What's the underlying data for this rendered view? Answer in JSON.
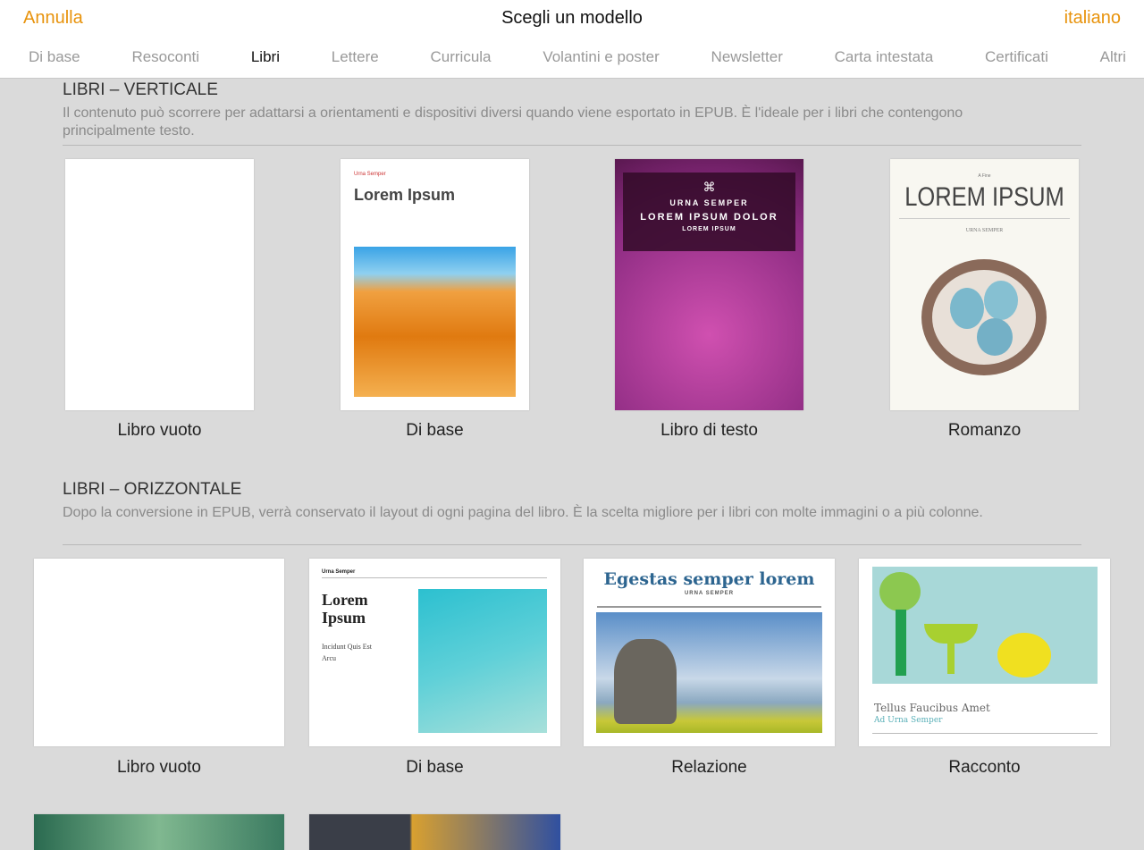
{
  "header": {
    "cancel": "Annulla",
    "title": "Scegli un modello",
    "language": "italiano"
  },
  "tabs": [
    "Di base",
    "Resoconti",
    "Libri",
    "Lettere",
    "Curricula",
    "Volantini e poster",
    "Newsletter",
    "Carta intestata",
    "Certificati",
    "Altri"
  ],
  "active_tab": "Libri",
  "sections": [
    {
      "title": "LIBRI – VERTICALE",
      "description": "Il contenuto può scorrere per adattarsi a orientamenti e dispositivi diversi quando viene esportato in EPUB. È l'ideale per i libri che contengono principalmente testo.",
      "templates": [
        {
          "label": "Libro vuoto"
        },
        {
          "label": "Di base",
          "small": "Urna Semper",
          "heading": "Lorem Ipsum"
        },
        {
          "label": "Libro di testo",
          "line1": "URNA SEMPER",
          "line2": "LOREM IPSUM DOLOR",
          "line3": "LOREM IPSUM"
        },
        {
          "label": "Romanzo",
          "small": "A Fine",
          "heading": "LOREM IPSUM",
          "author": "URNA SEMPER"
        }
      ]
    },
    {
      "title": "LIBRI – ORIZZONTALE",
      "description": "Dopo la conversione in EPUB, verrà conservato il layout di ogni pagina del libro. È la scelta migliore per i libri con molte immagini o a più colonne.",
      "templates": [
        {
          "label": "Libro vuoto"
        },
        {
          "label": "Di base",
          "small": "Urna Semper",
          "heading": "Lorem Ipsum",
          "sub": "Incidunt Quis Est Arcu"
        },
        {
          "label": "Relazione",
          "heading": "Egestas semper lorem",
          "author": "URNA SEMPER"
        },
        {
          "label": "Racconto",
          "heading": "Tellus Faucibus Amet",
          "sub": "Ad Urna Semper"
        }
      ]
    }
  ]
}
